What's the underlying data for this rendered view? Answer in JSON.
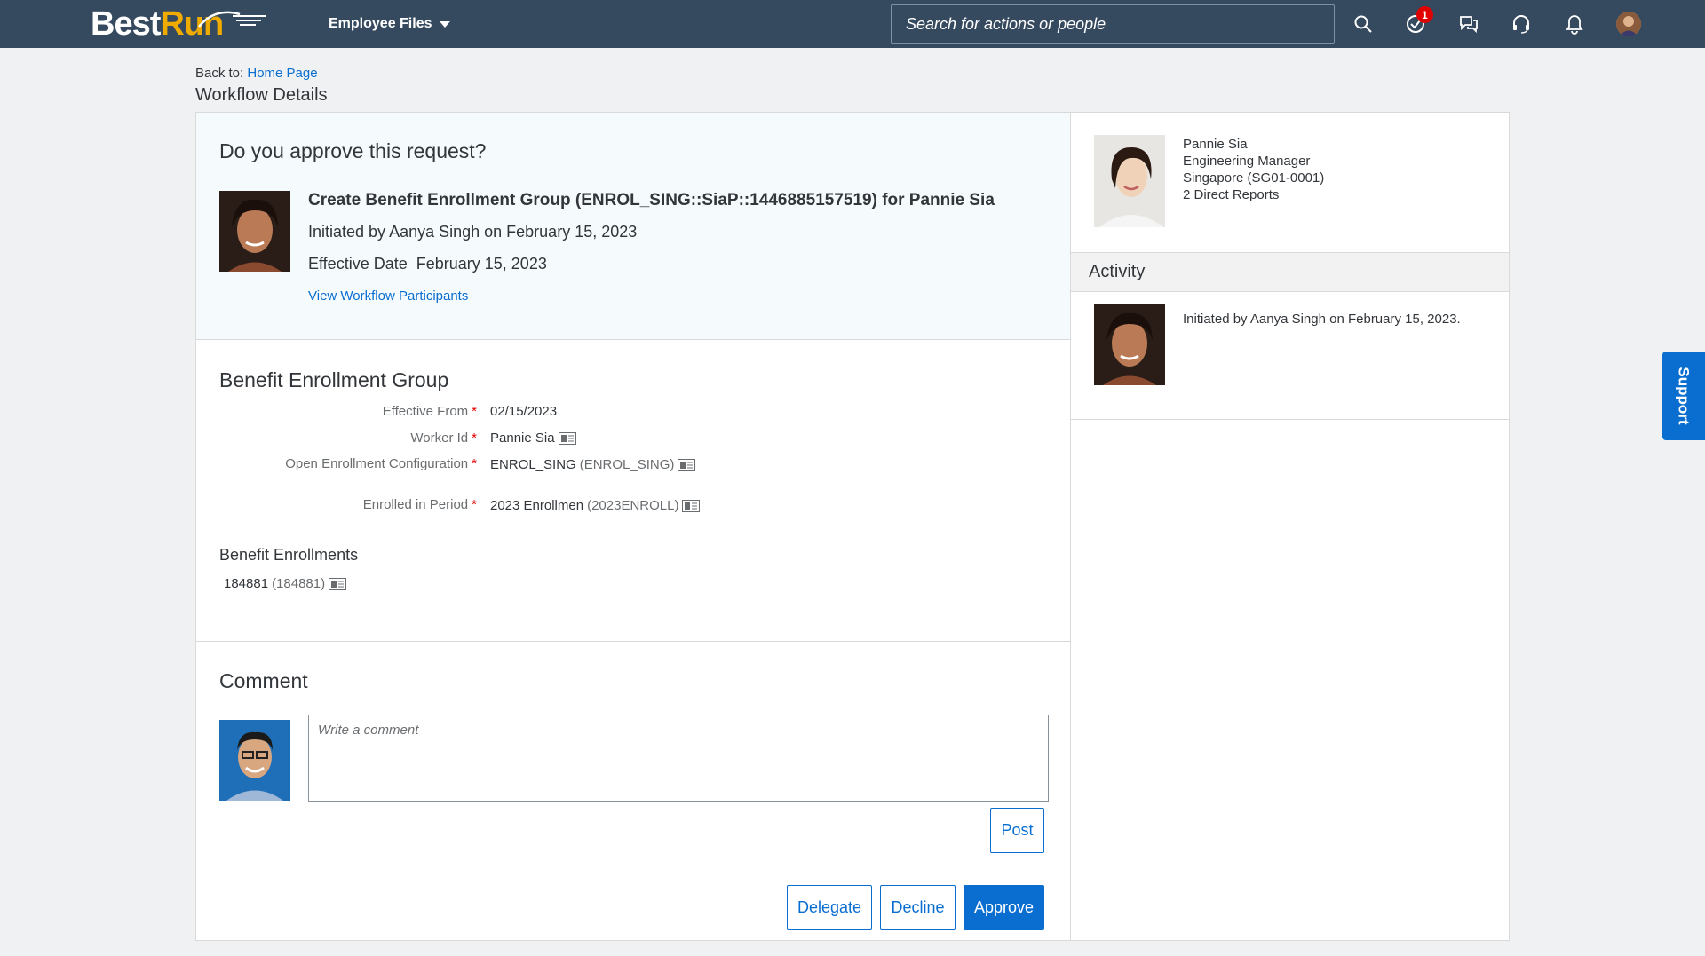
{
  "shell": {
    "logo_best": "Best",
    "logo_run": "Run",
    "app_menu_label": "Employee Files",
    "search_placeholder": "Search for actions or people",
    "todo_badge": "1",
    "icons": [
      "search-icon",
      "todo-check-icon",
      "messages-icon",
      "support-headset-icon",
      "notification-bell-icon",
      "user-avatar"
    ]
  },
  "breadcrumb": {
    "back_prefix": "Back to:",
    "back_link": "Home Page",
    "page_title": "Workflow Details"
  },
  "request": {
    "question": "Do you approve this request?",
    "title": "Create Benefit Enrollment Group (ENROL_SING::SiaP::1446885157519) for Pannie Sia",
    "initiated": "Initiated by Aanya Singh on February 15, 2023",
    "effective_label": "Effective Date",
    "effective_value": "February 15, 2023",
    "view_participants": "View Workflow Participants"
  },
  "benefit_group": {
    "title": "Benefit Enrollment Group",
    "fields": [
      {
        "label": "Effective From",
        "value": "02/15/2023",
        "secondary": "",
        "required": "*"
      },
      {
        "label": "Worker Id",
        "value": "Pannie Sia",
        "secondary": "",
        "required": "*"
      },
      {
        "label": "Open Enrollment Configuration",
        "value": "ENROL_SING",
        "secondary": "(ENROL_SING)",
        "required": "*"
      },
      {
        "label": "Enrolled in Period",
        "value": "2023 Enrollmen",
        "secondary": "(2023ENROLL)",
        "required": "*"
      }
    ],
    "enrollments_title": "Benefit Enrollments",
    "enrollment_value": "184881",
    "enrollment_secondary": "(184881)"
  },
  "comment": {
    "title": "Comment",
    "placeholder": "Write a comment",
    "post_label": "Post"
  },
  "actions": {
    "delegate": "Delegate",
    "decline": "Decline",
    "approve": "Approve"
  },
  "profile": {
    "name": "Pannie Sia",
    "role": "Engineering Manager",
    "location": "Singapore (SG01-0001)",
    "reports": "2 Direct Reports"
  },
  "activity": {
    "title": "Activity",
    "entry": "Initiated by Aanya Singh on February 15, 2023."
  },
  "support": {
    "label": "Support"
  },
  "colors": {
    "shell_bg": "#354a5f",
    "accent": "#0a6ed1",
    "logo_run": "#f0ab00",
    "required": "#e00000",
    "page_bg": "#eff1f3"
  }
}
